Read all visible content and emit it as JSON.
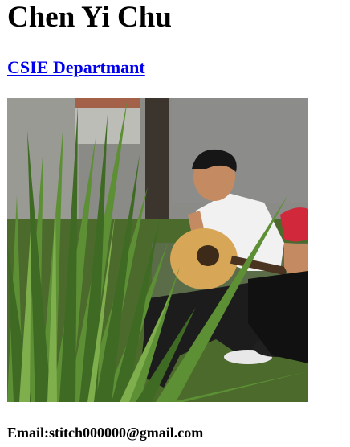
{
  "profile": {
    "name": "Chen Yi Chu",
    "department_link_text": "CSIE Departmant",
    "email_label": "Email:",
    "email_value": "stitch000000@gmail.com"
  },
  "photo": {
    "alt": "Person playing acoustic guitar among tall green plants",
    "colors": {
      "wall": "#8e8e8e",
      "foliage_dark": "#2f4a1e",
      "foliage_light": "#6e9a3a",
      "shirt": "#f2f2f2",
      "pants": "#1b1b1b",
      "guitar_body": "#d7a656",
      "sleeve_red": "#d2283c",
      "skin": "#c48a62"
    }
  }
}
